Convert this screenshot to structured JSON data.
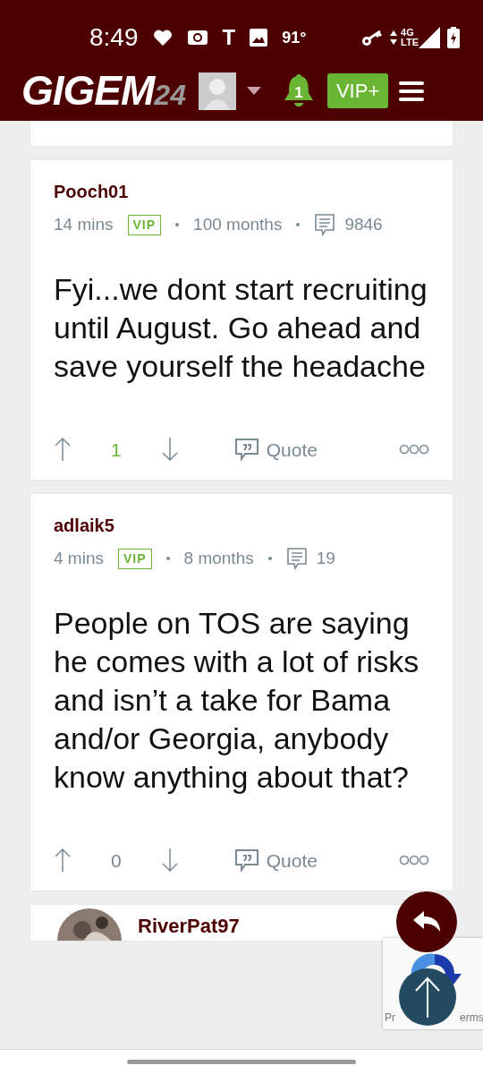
{
  "status_bar": {
    "time": "8:49",
    "glyph": "T",
    "temperature": "91°",
    "network": [
      "4G",
      "LTE"
    ]
  },
  "header": {
    "logo": [
      "GIGEM",
      "24"
    ],
    "notifications": "1",
    "vip_button": "VIP+"
  },
  "posts": [
    {
      "author": "Pooch01",
      "time": "14 mins",
      "badge": "VIP",
      "tenure": "100 months",
      "post_count": "9846",
      "body": "Fyi...we dont start recruiting until August. Go ahead and save yourself the headache",
      "votes": "1",
      "positive": true,
      "quote": "Quote"
    },
    {
      "author": "adlaik5",
      "time": "4 mins",
      "badge": "VIP",
      "tenure": "8 months",
      "post_count": "19",
      "body": "People on TOS are saying he comes with a lot of risks and isn’t a take for Bama and/or Georgia, anybody know anything about that?",
      "votes": "0",
      "positive": false,
      "quote": "Quote"
    }
  ],
  "next_post": {
    "author": "RiverPat97"
  },
  "recaptcha": {
    "texts": [
      "Pr",
      "erms"
    ]
  }
}
